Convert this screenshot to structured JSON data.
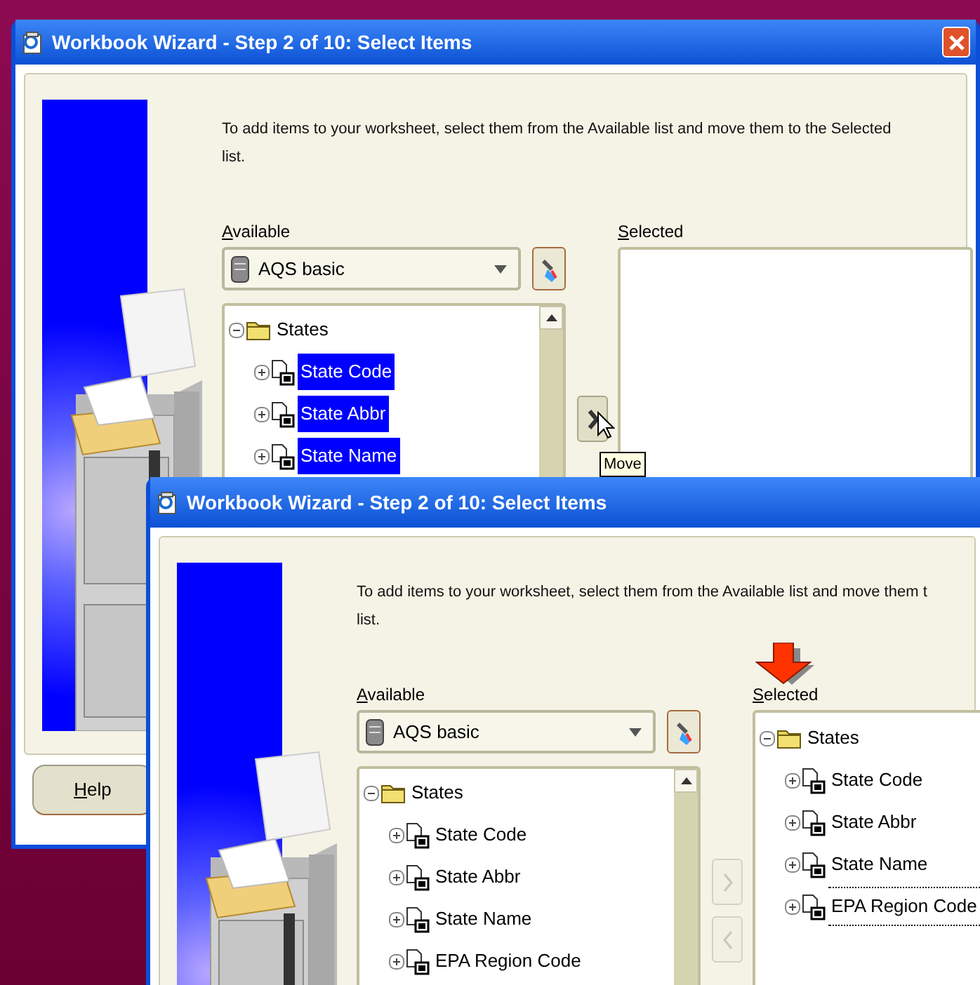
{
  "windows": [
    {
      "title": "Workbook Wizard - Step 2 of 10: Select Items",
      "close_button": true,
      "instruction_lines": [
        "To add items to your worksheet, select them from the Available list and move them to the Selected",
        "list."
      ],
      "available_label": "Available",
      "selected_label": "Selected",
      "dropdown": {
        "value": "AQS basic"
      },
      "available_tree": {
        "label": "States",
        "expanded": true,
        "selected": false,
        "children": [
          {
            "label": "State Code",
            "selected": true
          },
          {
            "label": "State Abbr",
            "selected": true
          },
          {
            "label": "State Name",
            "selected": true
          }
        ]
      },
      "move_buttons": [
        {
          "kind": "add",
          "disabled": false
        }
      ],
      "cursor_on_button": true,
      "tooltip": "Move",
      "help_button": "Help"
    },
    {
      "title": "Workbook Wizard - Step 2 of 10: Select Items",
      "instruction_lines": [
        "To add items to your worksheet, select them from the Available list and move them t",
        "list."
      ],
      "available_label": "Available",
      "selected_label": "Selected",
      "dropdown": {
        "value": "AQS basic"
      },
      "available_tree": {
        "label": "States",
        "expanded": true,
        "selected": false,
        "children": [
          {
            "label": "State Code",
            "selected": false
          },
          {
            "label": "State Abbr",
            "selected": false
          },
          {
            "label": "State Name",
            "selected": false
          },
          {
            "label": "EPA Region Code",
            "selected": false
          }
        ]
      },
      "selected_tree": {
        "label": "States",
        "expanded": true,
        "focused": false,
        "children": [
          {
            "label": "State Code",
            "focused": false
          },
          {
            "label": "State Abbr",
            "focused": false
          },
          {
            "label": "State Name",
            "focused": false
          },
          {
            "label": "EPA Region Code",
            "focused": true
          }
        ]
      },
      "move_buttons": [
        {
          "kind": "add",
          "disabled": true
        },
        {
          "kind": "remove",
          "disabled": true
        }
      ],
      "arrow_to_selected": true
    }
  ]
}
